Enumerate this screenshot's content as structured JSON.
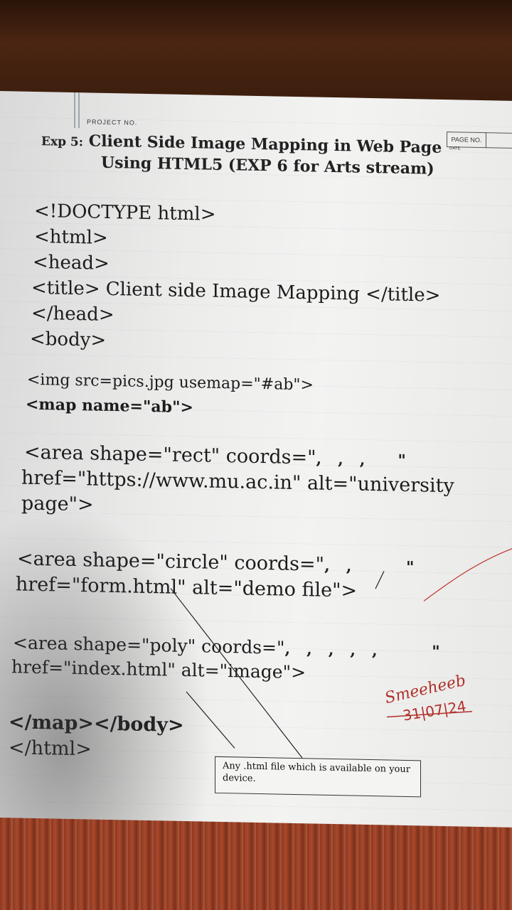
{
  "header": {
    "project_no": "PROJECT NO.",
    "page_no_label": "PAGE NO.",
    "date_label": "DATE",
    "exp_label": "Exp 5:",
    "title_line1": "Client Side Image Mapping in Web Page",
    "title_line2": "Using HTML5 (EXP 6 for Arts stream)"
  },
  "code": {
    "l1": "<!DOCTYPE html>",
    "l2": "<html>",
    "l3": "<head>",
    "l4": "<title> Client side Image Mapping </title>",
    "l5": "</head>",
    "l6": "<body>",
    "l7": "<img src=pics.jpg usemap=\"#ab\">",
    "l8": "<map name=\"ab\">",
    "l9": "<area shape=\"rect\" coords=\"",
    "l9_tail": ",   ,   ,      \"",
    "l10": "href=\"https://www.mu.ac.in\" alt=\"university",
    "l11": "page\">",
    "l12": "<area shape=\"circle\" coords=\"",
    "l12_tail": ",   ,          \"",
    "l13": "href=\"form.html\" alt=\"demo file\">",
    "l14": "<area shape=\"poly\" coords=\"",
    "l14_tail": ",   ,   ,   ,   ,          \"",
    "l15": "href=\"index.html\" alt=\"image\">",
    "l16": "</map></body>",
    "l17": "</html>"
  },
  "callout": {
    "text": "Any .html file which is available on your device."
  },
  "signature": {
    "name": "Smeeheeb",
    "date": "31|07|24"
  }
}
